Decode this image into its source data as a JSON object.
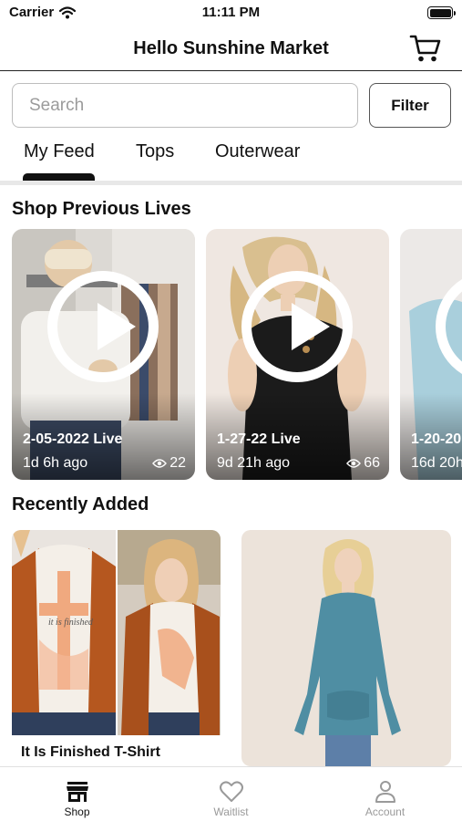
{
  "status_bar": {
    "carrier": "Carrier",
    "time": "11:11 PM"
  },
  "nav": {
    "title": "Hello Sunshine Market",
    "cart_icon": "cart-icon"
  },
  "search": {
    "placeholder": "Search",
    "value": "",
    "filter_label": "Filter"
  },
  "tabs": [
    {
      "label": "My Feed",
      "active": true
    },
    {
      "label": "Tops",
      "active": false
    },
    {
      "label": "Outerwear",
      "active": false
    }
  ],
  "sections": {
    "previous_lives": "Shop Previous Lives",
    "recently_added": "Recently Added"
  },
  "lives": [
    {
      "title": "2-05-2022 Live",
      "ago": "1d 6h ago",
      "views": "22"
    },
    {
      "title": "1-27-22 Live",
      "ago": "9d 21h ago",
      "views": "66"
    },
    {
      "title": "1-20-20",
      "ago": "16d 20h",
      "views": ""
    }
  ],
  "products": [
    {
      "name": "It Is Finished T-Shirt",
      "shirt_text": "it is finished"
    },
    {
      "name": ""
    }
  ],
  "tab_bar": [
    {
      "label": "Shop",
      "icon": "storefront-icon",
      "active": true
    },
    {
      "label": "Waitlist",
      "icon": "heart-icon",
      "active": false
    },
    {
      "label": "Account",
      "icon": "person-icon",
      "active": false
    }
  ],
  "colors": {
    "accent": "#111111",
    "inactive": "#9a9a9a",
    "divider": "#e8e8e8"
  }
}
